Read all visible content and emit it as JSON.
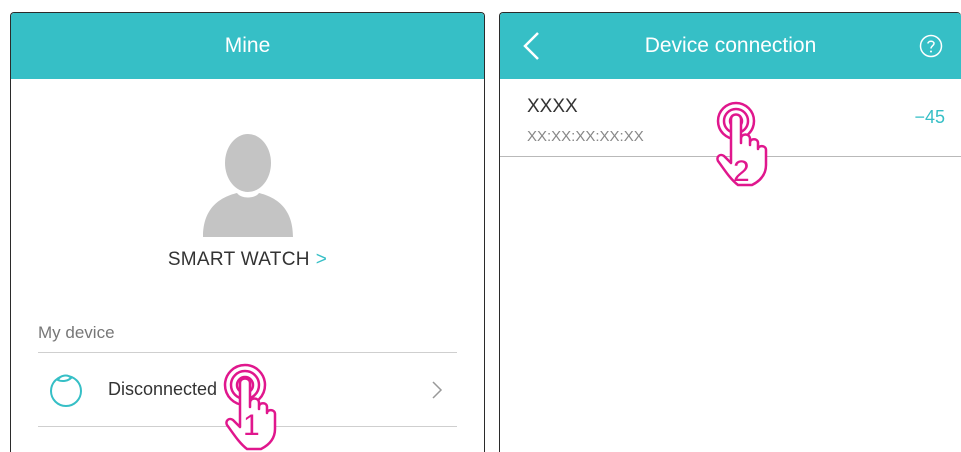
{
  "colors": {
    "header": "#36bfc6",
    "accent": "#36bfc6",
    "annotation": "#e0178d"
  },
  "left_screen": {
    "header": {
      "title": "Mine"
    },
    "profile": {
      "name": "SMART WATCH",
      "chevron": ">",
      "avatar_icon": "user-avatar-icon"
    },
    "section_label": "My device",
    "device": {
      "status": "Disconnected",
      "icon": "watch-icon",
      "chevron_icon": "chevron-right-icon"
    },
    "step_number": "1"
  },
  "right_screen": {
    "header": {
      "title": "Device connection",
      "back_icon": "back-arrow-icon",
      "help_icon": "help-icon"
    },
    "scan_result": {
      "name": "XXXX",
      "mac": "XX:XX:XX:XX:XX",
      "rssi": "−45"
    },
    "step_number": "2"
  }
}
